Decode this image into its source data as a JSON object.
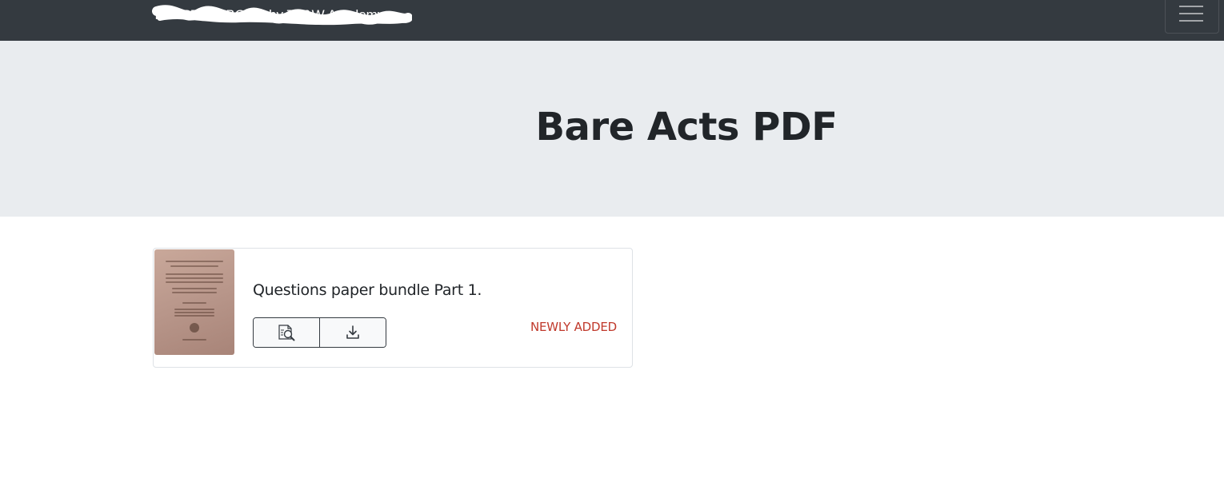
{
  "navbar": {
    "brand": "YOURTEXTBOOK by TL&W Academy",
    "background_color": "#343a40",
    "menu_icon": "hamburger-menu-icon"
  },
  "header": {
    "title": "Bare Acts PDF",
    "background_color": "#e9ecef"
  },
  "items": [
    {
      "title": "Questions paper bundle Part 1.",
      "thumbnail": "document-cover-thumbnail",
      "actions": [
        {
          "icon": "preview-document-icon"
        },
        {
          "icon": "download-icon"
        }
      ],
      "badge": "NEWLY ADDED",
      "badge_color": "#c0392b"
    }
  ]
}
